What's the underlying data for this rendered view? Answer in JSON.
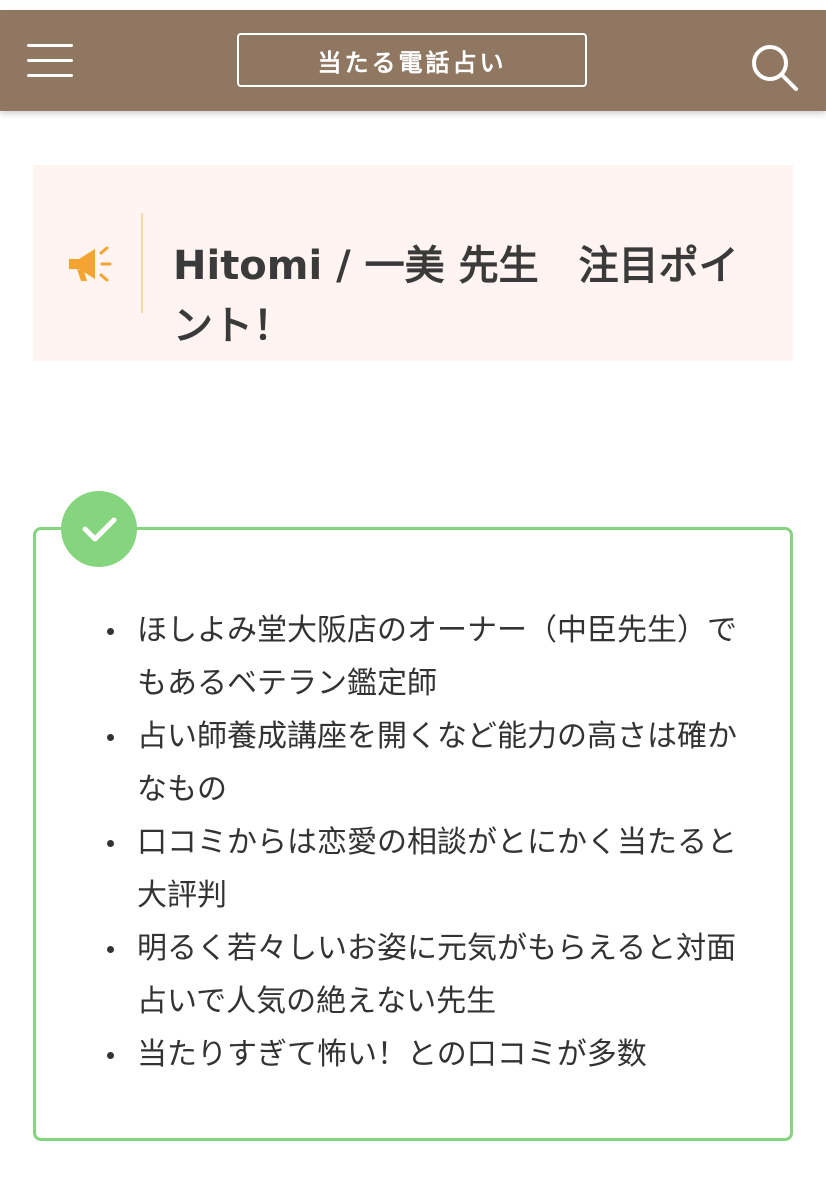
{
  "header": {
    "logo_text": "当たる電話占い",
    "menu_icon": "hamburger-menu-icon",
    "search_icon": "search-icon",
    "background_color": "#8f7761"
  },
  "point_box": {
    "title": "Hitomi / 一美 先生　注目ポイント！",
    "icon": "megaphone-icon",
    "icon_color": "#f5a431",
    "background_color": "#fff4f1"
  },
  "checklist": {
    "icon": "checkmark-icon",
    "accent_color": "#85d47e",
    "items": [
      "ほしよみ堂大阪店のオーナー（中臣先生）でもあるベテラン鑑定師",
      "占い師養成講座を開くなど能力の高さは確かなもの",
      "口コミからは恋愛の相談がとにかく当たると大評判",
      "明るく若々しいお姿に元気がもらえると対面占いで人気の絶えない先生",
      "当たりすぎて怖い！との口コミが多数"
    ]
  }
}
